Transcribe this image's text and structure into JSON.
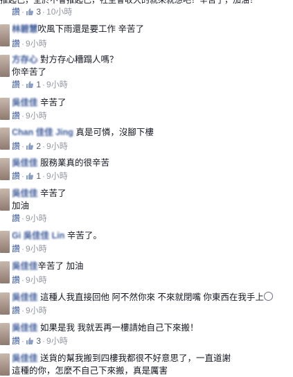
{
  "top": {
    "text": "推起己，全於不會推起己，社至會收大的就來就想吧？辛苦了，加油！",
    "read": "讚",
    "likes": "3",
    "time": "10小時"
  },
  "comments": [
    {
      "name": "林碧慧",
      "message": "吹風下雨還是要工作 辛苦了",
      "read": "讚",
      "likes": "",
      "time": "9小時"
    },
    {
      "name": "方存心",
      "message": "對方存心糟蹋人嗎？",
      "message2": "你辛苦了",
      "read": "讚",
      "likes": "1",
      "time": "9小時"
    },
    {
      "name": "吳佳佳",
      "message": "辛苦了",
      "read": "讚",
      "likes": "",
      "time": "9小時"
    },
    {
      "name": "Chan 佳佳 Jing",
      "message": "真是可憐，沒腳下樓",
      "read": "讚",
      "likes": "2",
      "time": "9小時"
    },
    {
      "name": "吳佳佳",
      "message": "服務業真的很辛苦",
      "read": "讚",
      "likes": "1",
      "time": "9小時"
    },
    {
      "name": "吳佳佳",
      "message": "辛苦了",
      "message2": "加油",
      "read": "讚",
      "likes": "",
      "time": "9小時"
    },
    {
      "name": "Gi 吳佳佳 Lin",
      "message": "辛苦了。",
      "read": "讚",
      "likes": "",
      "time": "9小時"
    },
    {
      "name": "吳佳佳",
      "message": "辛苦了 加油",
      "read": "讚",
      "likes": "",
      "time": "9小時"
    },
    {
      "name": "吳佳佳",
      "message": "這種人我直接回他 阿不然你來 不來就閉嘴 你東西在我手上",
      "read": "讚",
      "likes": "",
      "time": "9小時"
    },
    {
      "name": "吳佳佳",
      "message": "如果是我 我就丟再一樓請她自己下來搬！",
      "read": "讚",
      "likes": "3",
      "time": "9小時"
    },
    {
      "name": "吳佳佳",
      "message": "送貨的幫我搬到四樓我都很不好意思了，一直道謝",
      "message2": "這種的你，怎麼不自己下來搬，真是厲害",
      "read": "",
      "likes": "",
      "time": ""
    }
  ],
  "colors": {
    "link": "#3b5998",
    "meta": "#9197a3",
    "text": "#141823"
  }
}
